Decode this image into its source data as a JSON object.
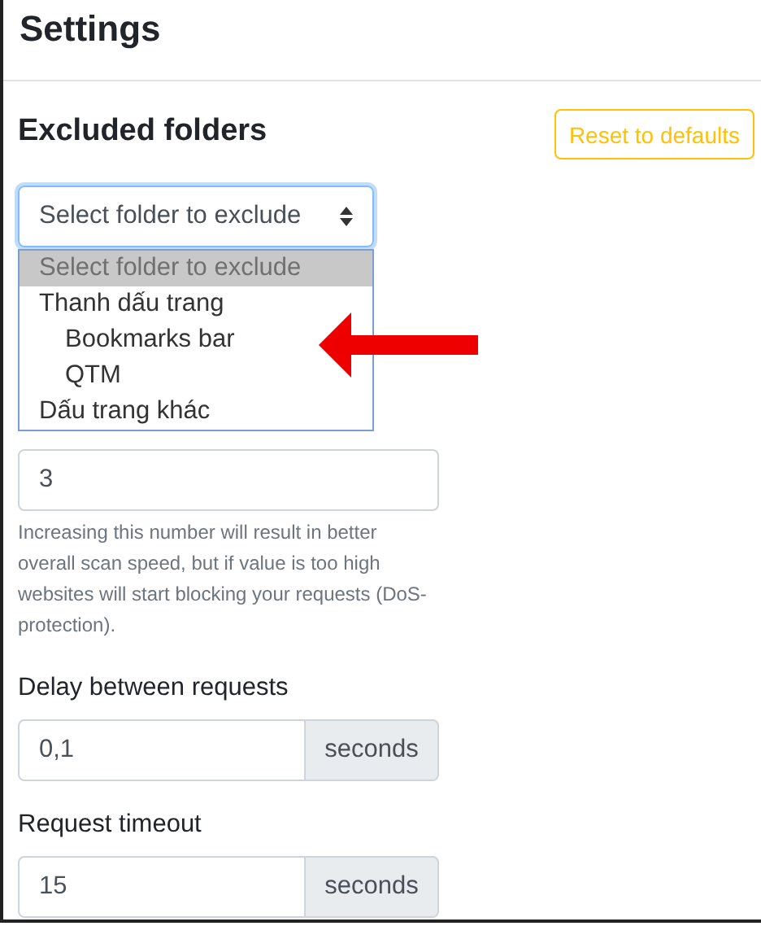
{
  "window": {
    "title": "Settings"
  },
  "section": {
    "title": "Excluded folders",
    "reset_button": "Reset to defaults"
  },
  "folder_select": {
    "value": "Select folder to exclude",
    "expanded": true,
    "options": [
      {
        "label": "Select folder to exclude",
        "selected": true
      },
      {
        "label": "Thanh dấu trang",
        "selected": false,
        "children": [
          {
            "label": "Bookmarks bar",
            "selected": false
          },
          {
            "label": "QTM",
            "selected": false
          }
        ]
      },
      {
        "label": "Dấu trang khác",
        "selected": false
      }
    ]
  },
  "threads_field": {
    "value": "3",
    "help": "Increasing this number will result in better overall scan speed, but if value is too high websites will start blocking your requests (DoS-protection)."
  },
  "fields": [
    {
      "label": "Delay between requests",
      "value": "0,1",
      "unit": "seconds"
    },
    {
      "label": "Request timeout",
      "value": "15",
      "unit": "seconds"
    }
  ]
}
